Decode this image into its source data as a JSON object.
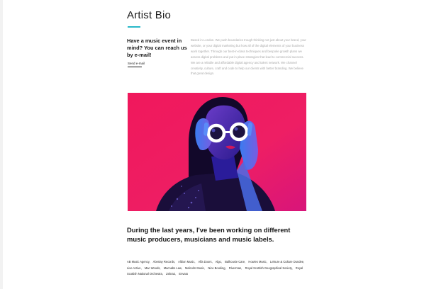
{
  "page": {
    "title": "Artist Bio"
  },
  "contact": {
    "heading": "Have a music event in mind? You can reach us by e-mail!",
    "send_mail_label": "Send e-mail"
  },
  "bio": {
    "text": "Based in London. We push boundaries trough thinking not just about your brand, your website, or your digital marketing but how all of the digital elements of your business work together. Through our best-in-class techniques and bespoke growth plans we assess digital problems and put in place strategies that lead to commercial success. We are a reliable and affordable digital agency and talent network. We channel creativity, culture, craft and code to help our clients with better branding. We believe that great design."
  },
  "image": {
    "alt": "Woman with round white sunglasses on pink background"
  },
  "headline": {
    "text": "During the last  years, I've  been working on different music producers, musicians and music labels."
  },
  "clients": {
    "items": [
      "AB Music Agency,",
      "Abertay Records,",
      "Albion Music,",
      "Alfa Doors,",
      "Algo,",
      "Balhousie Care,",
      "Howies Music,",
      "Leisure & Culture Dundee,",
      "Live Active,",
      "Mac Woods,",
      "Macnabs Law,",
      "Malcolm Music,",
      "Nice Booking,",
      "Riverman,",
      "Royal Scottish Geographical Society,",
      "Royal Scottish National Orchestra,",
      "Zebra2,",
      "Envato"
    ]
  },
  "colors": {
    "accent": "#28b8c8",
    "image_background": "#ee1e64"
  }
}
